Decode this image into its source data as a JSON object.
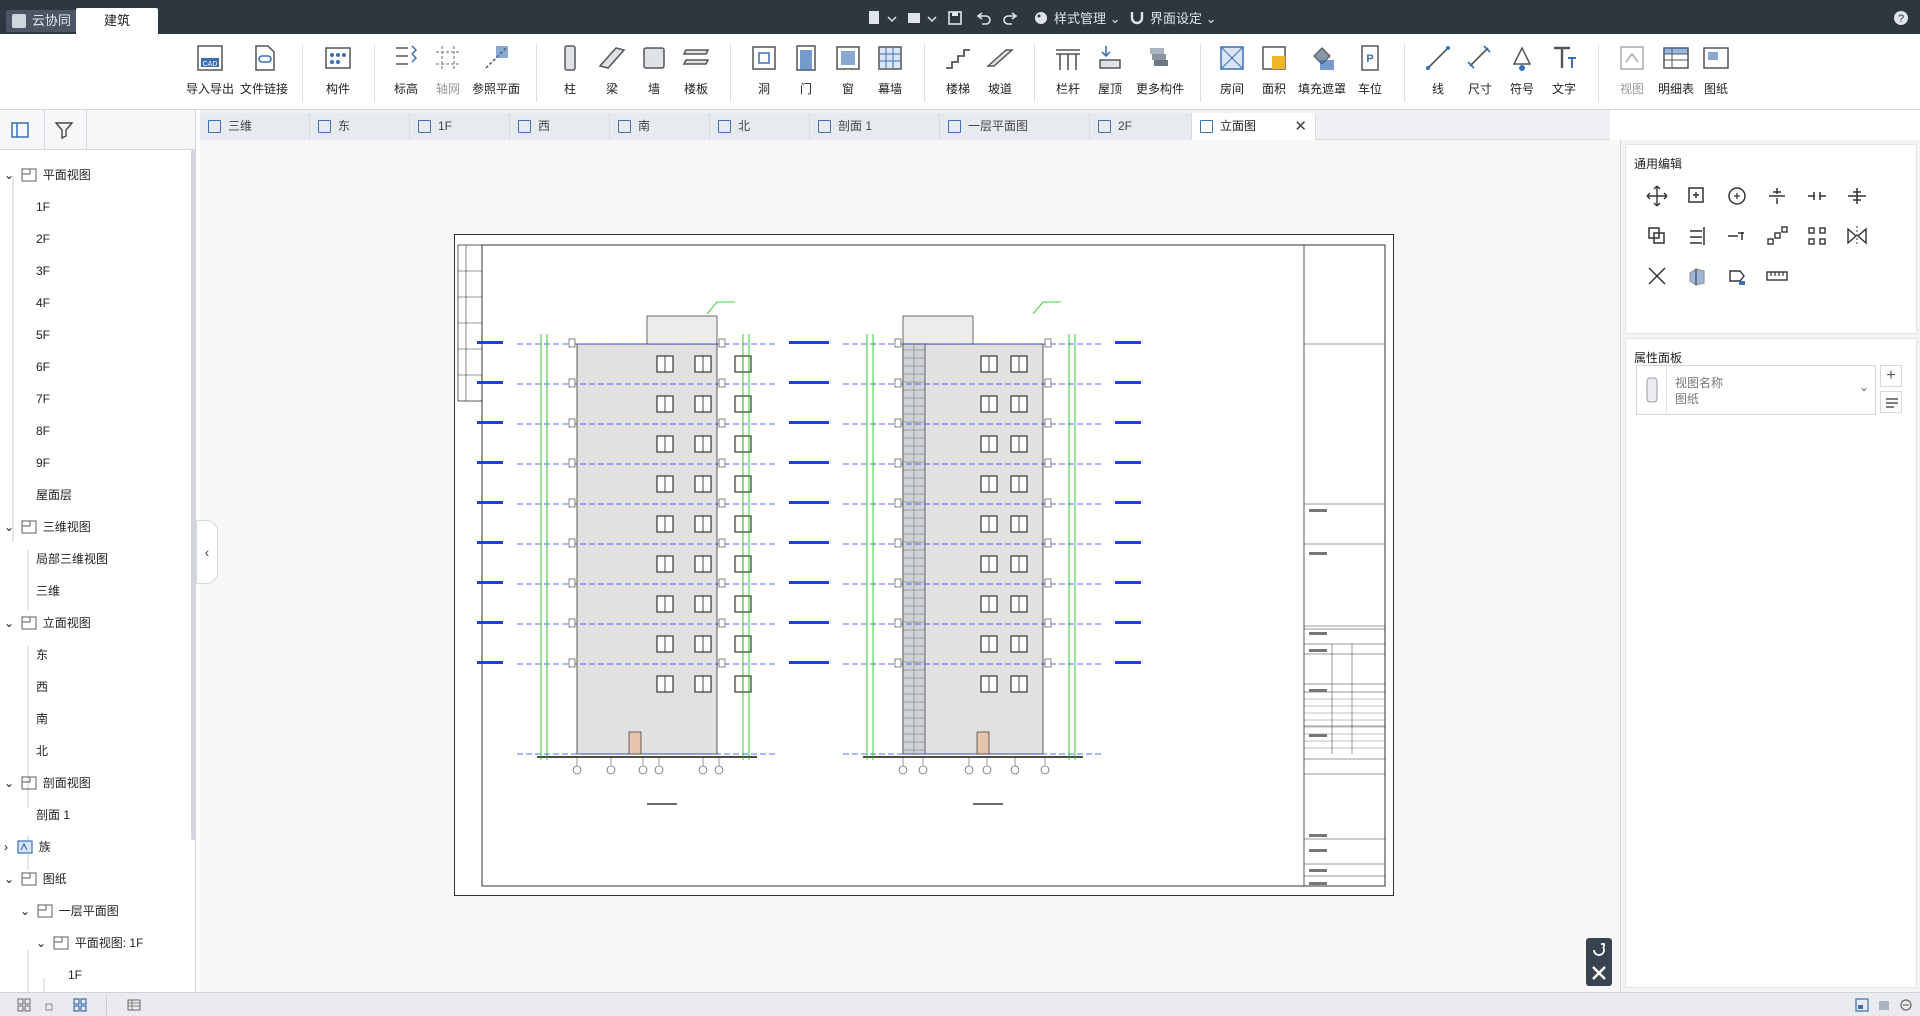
{
  "app_tabs": {
    "cloud": "云协同",
    "active": "建筑"
  },
  "quick_access": {
    "style_manage": "样式管理",
    "ui_settings": "界面设定"
  },
  "ribbon": {
    "import_export": "导入导出",
    "file_link": "文件链接",
    "component": "构件",
    "elevation_mark": "标高",
    "axis_grid": "轴网",
    "ref_plane": "参照平面",
    "column": "柱",
    "beam": "梁",
    "wall": "墙",
    "slab": "楼板",
    "opening": "洞",
    "door": "门",
    "window": "窗",
    "curtain_wall": "幕墙",
    "stair": "楼梯",
    "ramp": "坡道",
    "railing": "栏杆",
    "roof": "屋顶",
    "more_components": "更多构件",
    "room": "房间",
    "area": "面积",
    "fill_mask": "填充遮罩",
    "parking": "车位",
    "line": "线",
    "dimension": "尺寸",
    "symbol": "符号",
    "text": "文字",
    "view": "视图",
    "schedule": "明细表",
    "sheet": "图纸"
  },
  "tree": {
    "plan_views": "平面视图",
    "plan_items": [
      "1F",
      "2F",
      "3F",
      "4F",
      "5F",
      "6F",
      "7F",
      "8F",
      "9F",
      "屋面层"
    ],
    "views_3d": "三维视图",
    "items_3d": [
      "局部三维视图",
      "三维"
    ],
    "elevation_views": "立面视图",
    "elevation_items": [
      "东",
      "西",
      "南",
      "北"
    ],
    "section_views": "剖面视图",
    "section_items": [
      "剖面 1"
    ],
    "family": "族",
    "sheets": "图纸",
    "sheet_item": "一层平面图",
    "sheet_sub": "平面视图: 1F",
    "sheet_sub_item": "1F"
  },
  "view_tabs": [
    "三维",
    "东",
    "1F",
    "西",
    "南",
    "北",
    "剖面 1",
    "一层平面图",
    "2F",
    "立面图"
  ],
  "active_view_tab": "立面图",
  "right_panel": {
    "general_edit_title": "通用编辑",
    "properties_title": "属性面板",
    "view_name_label": "视图名称",
    "view_name_value": "图纸"
  },
  "colors": {
    "titlebar": "#2e3640",
    "accent": "#3b6fb6",
    "level_line": "#1e3cff",
    "dim_line": "#00c800"
  }
}
